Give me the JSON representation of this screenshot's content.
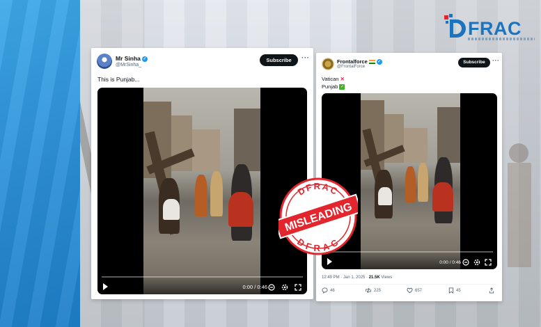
{
  "brand": {
    "logo_text": "FRAC",
    "logo_color": "#1e73be"
  },
  "tweet_left": {
    "name": "Mr Sinha",
    "handle": "@MrSinha_",
    "subscribe_label": "Subscribe",
    "more_label": "···",
    "text": "This is Punjab...",
    "video": {
      "time": "0:00 / 0:46"
    }
  },
  "tweet_right": {
    "name": "Frontalforce",
    "handle": "@FrontalForce",
    "subscribe_label": "Subscribe",
    "more_label": "···",
    "text_line1": "Vatican",
    "text_line2": "Punjab",
    "video": {
      "time": "0:00 / 0:46"
    },
    "meta_time": "12:49 PM · Jan 1, 2025 ·",
    "views_count": "21.5K",
    "views_label": "Views",
    "actions": {
      "replies": "46",
      "reposts": "225",
      "likes": "657",
      "bookmarks": "45"
    }
  },
  "stamp": {
    "top_text": "DFRAC",
    "center_text": "MISLEADING",
    "bottom_text": "DFRAC",
    "color": "#e3262e"
  },
  "icons": [
    "verified-badge-icon",
    "india-flag-icon",
    "x-mark-icon",
    "check-mark-icon",
    "play-icon",
    "caption-icon",
    "settings-icon",
    "fullscreen-icon",
    "reply-icon",
    "repost-icon",
    "like-icon",
    "bookmark-icon",
    "share-icon"
  ]
}
